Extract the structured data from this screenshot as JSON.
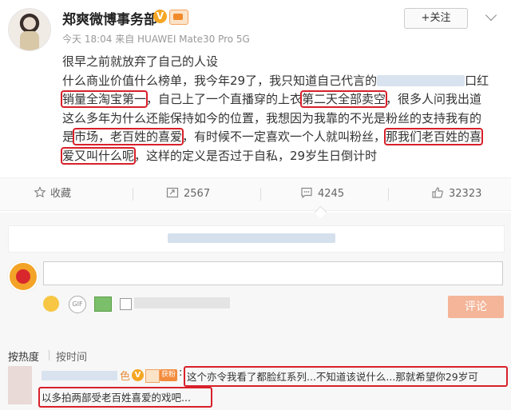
{
  "header": {
    "username": "郑爽微博事务部",
    "verified": "V",
    "follow_label": "+关注",
    "meta": "今天 18:04 来自 HUAWEI Mate30 Pro 5G"
  },
  "post": {
    "line1": "很早之前就放弃了自己的人设",
    "line2a": "什么商业价值什么榜单，我今年29了，我只知道自己代言的",
    "line2b": "口红",
    "line3a": "销量全淘宝第一",
    "line3b": "，自己上了一个直播穿的上衣",
    "line3c": "第二天全部卖空",
    "line3d": "，很多人问我出道",
    "line4": "这么多年为什么还能保持如今的位置，我想因为我靠的不光是粉丝的支持我有的",
    "line5a": "是",
    "line5b": "市场，老百姓的喜爱",
    "line5c": "，有时候不一定喜欢一个人就叫粉丝，",
    "line5d": "那我们老百姓的喜",
    "line6a": "爱又叫什么呢",
    "line6b": "，这样的定义是否过于自私，29岁生日倒计时"
  },
  "actions": {
    "favorite": "收藏",
    "repost": "2567",
    "comment": "4245",
    "like": "32323"
  },
  "composer": {
    "submit_label": "评论",
    "icons": [
      "emoji-icon",
      "gif-icon",
      "image-icon"
    ]
  },
  "sort": {
    "by_hot": "按热度",
    "by_time": "按时间"
  },
  "comment": {
    "name_suffix": "色",
    "badge": "获粉",
    "text1": "这个亦令我看了都脸红系列...不知道该说什么...那就希望你29岁可",
    "text2": "以多拍两部受老百姓喜爱的戏吧..."
  },
  "colors": {
    "highlight": "#d8202a",
    "submit_disabled": "#f4b599",
    "verified": "#f5a623"
  }
}
